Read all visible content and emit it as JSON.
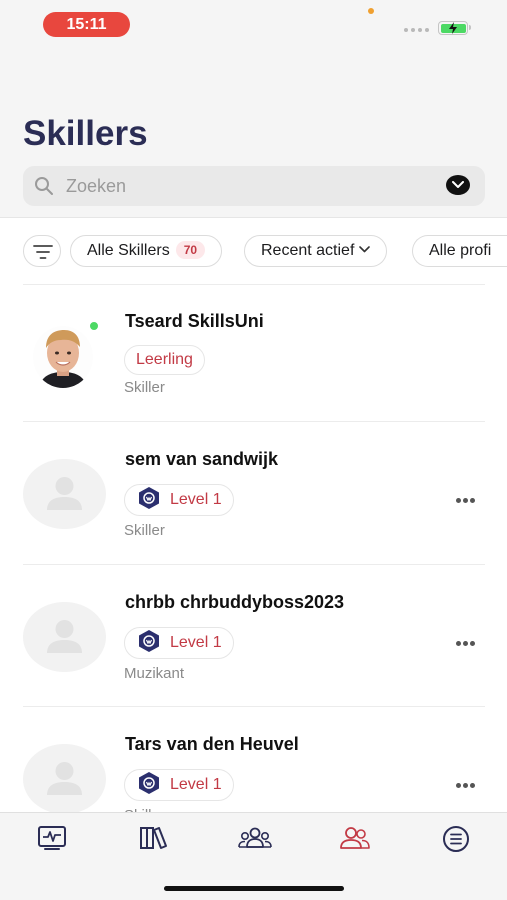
{
  "status_bar": {
    "time": "15:11",
    "battery_color": "#4cd964",
    "time_pill_color": "#e8473e"
  },
  "header": {
    "title": "Skillers",
    "search": {
      "placeholder": "Zoeken"
    }
  },
  "filters": {
    "filter_icon": "filter-lines-icon",
    "chips": [
      {
        "label": "Alle Skillers",
        "badge": "70"
      },
      {
        "label": "Recent actief",
        "dropdown": true
      },
      {
        "label": "Alle profi"
      }
    ]
  },
  "members": [
    {
      "name": "Tseard SkillsUni",
      "tag": "Leerling",
      "tag_kind": "role",
      "type": "Skiller",
      "online": true,
      "avatar": "photo",
      "has_more": false
    },
    {
      "name": "sem van sandwijk",
      "tag": "Level 1",
      "tag_kind": "level",
      "type": "Skiller",
      "online": false,
      "avatar": "placeholder",
      "has_more": true
    },
    {
      "name": "chrbb chrbuddyboss2023",
      "tag": "Level 1",
      "tag_kind": "level",
      "type": "Muzikant",
      "online": false,
      "avatar": "placeholder",
      "has_more": true
    },
    {
      "name": "Tars van den Heuvel",
      "tag": "Level 1",
      "tag_kind": "level",
      "type": "Skiller",
      "online": false,
      "avatar": "placeholder",
      "has_more": true
    }
  ],
  "tab_bar": {
    "tabs": [
      {
        "icon": "activity-icon",
        "active": false
      },
      {
        "icon": "library-icon",
        "active": false
      },
      {
        "icon": "groups-icon",
        "active": false
      },
      {
        "icon": "members-icon",
        "active": true
      },
      {
        "icon": "menu-list-icon",
        "active": false
      }
    ]
  },
  "colors": {
    "accent": "#c23a45",
    "title": "#2b2d55",
    "level_badge": "#2b2f6e"
  }
}
